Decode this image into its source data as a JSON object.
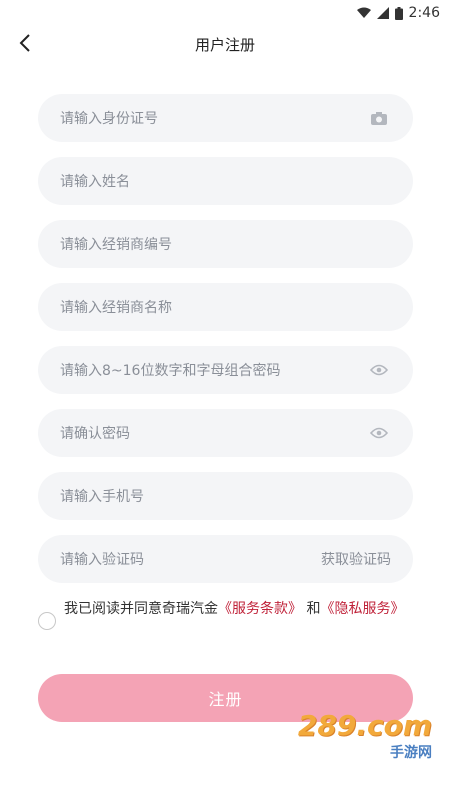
{
  "status_bar": {
    "time": "2:46",
    "icons": [
      "wifi-icon",
      "signal-icon",
      "battery-icon"
    ]
  },
  "header": {
    "title": "用户注册",
    "back_icon": "chevron-left-icon"
  },
  "form": {
    "id_number": {
      "placeholder": "请输入身份证号",
      "icon": "camera-icon"
    },
    "name": {
      "placeholder": "请输入姓名"
    },
    "dealer_code": {
      "placeholder": "请输入经销商编号"
    },
    "dealer_name": {
      "placeholder": "请输入经销商名称"
    },
    "password": {
      "placeholder": "请输入8~16位数字和字母组合密码",
      "icon": "eye-icon"
    },
    "confirm_password": {
      "placeholder": "请确认密码",
      "icon": "eye-icon"
    },
    "phone": {
      "placeholder": "请输入手机号"
    },
    "verify_code": {
      "placeholder": "请输入验证码",
      "button": "获取验证码"
    }
  },
  "agreement": {
    "prefix": "我已阅读并同意奇瑞汽金",
    "service_terms": "《服务条款》",
    "and": "和",
    "privacy": "《隐私服务》",
    "checked": false
  },
  "register_button": "注册",
  "watermark": {
    "main": "289.com",
    "sub": "手游网"
  },
  "colors": {
    "accent": "#f4a3b5",
    "link": "#c0233a",
    "field_bg": "#f4f5f7",
    "placeholder": "#8a8f98"
  }
}
